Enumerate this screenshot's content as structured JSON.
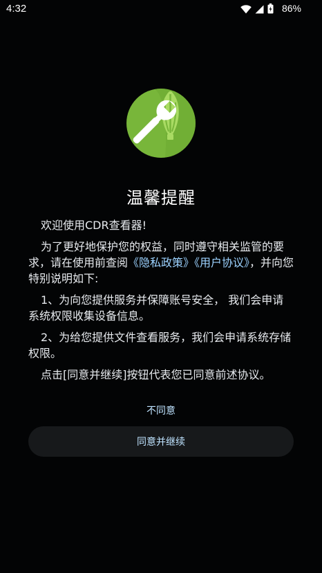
{
  "status_bar": {
    "time": "4:32",
    "battery_percent": "86%",
    "icons": [
      "wifi-icon",
      "cellular-signal-icon",
      "battery-icon"
    ]
  },
  "app": {
    "logo_icon": "cdr-viewer-logo",
    "brand_colors": {
      "logo_green": "#7cb83b",
      "logo_light_green": "#b5e36c"
    }
  },
  "dialog": {
    "title": "温馨提醒",
    "paragraphs": {
      "p1": "欢迎使用CDR查看器!",
      "p2_prefix": "为了更好地保护您的权益，同时遵守相关监管的要求，请在使用前查阅",
      "p2_privacy_link": "《隐私政策》",
      "p2_user_link": "《用户协议》",
      "p2_suffix": "，并向您特别说明如下:",
      "p3": "1、为向您提供服务并保障账号安全， 我们会申请系统权限收集设备信息。",
      "p4": "2、为给您提供文件查看服务，我们会申请系统存储权限。",
      "p5": "点击[同意并继续]按钮代表您已同意前述协议。"
    },
    "disagree_label": "不同意",
    "agree_label": "同意并继续",
    "colors": {
      "link": "#9cd2ff",
      "button_bg": "#17191b",
      "background": "#030405"
    }
  }
}
